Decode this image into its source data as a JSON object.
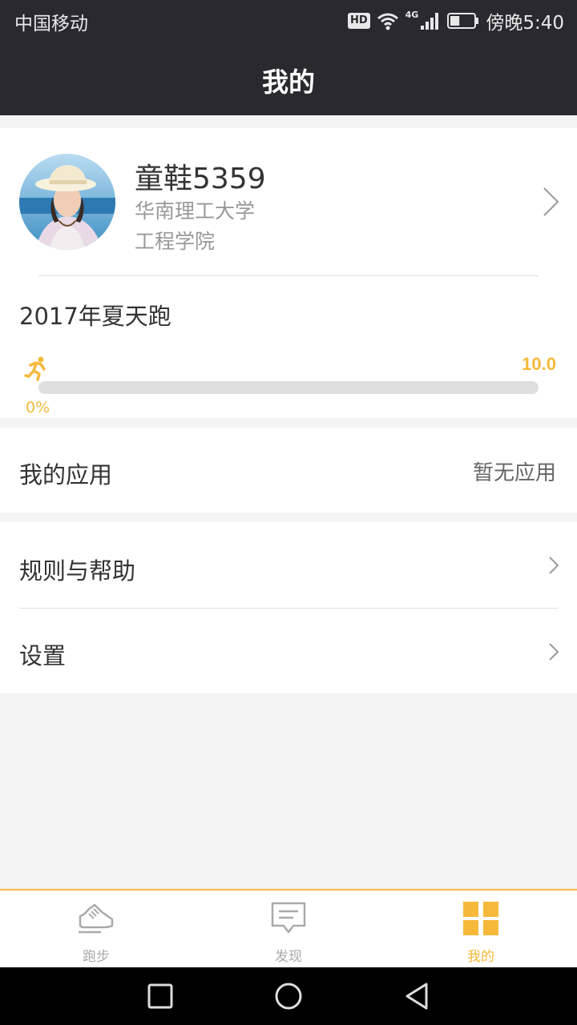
{
  "status": {
    "carrier": "中国移动",
    "hd": "HD",
    "network": "4G",
    "time": "傍晚5:40",
    "battery_level": 0.4
  },
  "header": {
    "title": "我的"
  },
  "profile": {
    "name": "童鞋5359",
    "school": "华南理工大学",
    "college": "工程学院"
  },
  "event": {
    "title": "2017年夏天跑",
    "progress_max": "10.0",
    "progress_percent": "0%",
    "progress_value": 0
  },
  "apps": {
    "label": "我的应用",
    "value": "暂无应用"
  },
  "menu": {
    "items": [
      {
        "label": "规则与帮助"
      },
      {
        "label": "设置"
      }
    ]
  },
  "tabs": [
    {
      "label": "跑步",
      "icon": "shoe-icon",
      "active": false
    },
    {
      "label": "发现",
      "icon": "message-icon",
      "active": false
    },
    {
      "label": "我的",
      "icon": "grid-icon",
      "active": true
    }
  ],
  "colors": {
    "accent": "#f6b93a",
    "header_bg": "#2a2a2e",
    "page_bg": "#f4f4f4"
  }
}
